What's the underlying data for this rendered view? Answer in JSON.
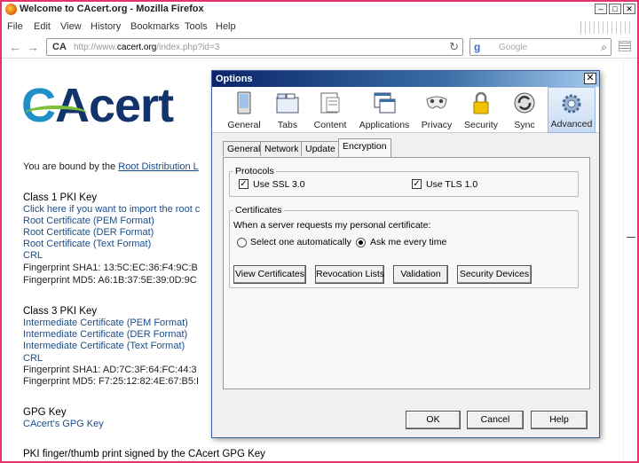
{
  "window": {
    "title": "Welcome to CAcert.org - Mozilla Firefox",
    "minimize": "–",
    "maximize": "□",
    "close": "✕"
  },
  "menu": [
    "File",
    "Edit",
    "View",
    "History",
    "Bookmarks",
    "Tools",
    "Help"
  ],
  "nav": {
    "back": "←",
    "forward": "→",
    "site_badge": "CA",
    "url_prefix": "http://www.",
    "url_domain": "cacert.org",
    "url_suffix": "/index.php?id=3",
    "reload": "↻",
    "search_engine": "g",
    "search_placeholder": "Google",
    "search_icon": "⌕"
  },
  "page": {
    "logo_c": "C",
    "logo_rest": "Acert",
    "bound_text": "You are bound by the ",
    "bound_link": "Root Distribution L",
    "class1": {
      "heading": "Class 1 PKI Key",
      "import": "Click here if you want to import the root c",
      "links": [
        "Root Certificate (PEM Format)",
        "Root Certificate (DER Format)",
        "Root Certificate (Text Format)",
        "CRL"
      ],
      "sha1": "Fingerprint SHA1: 13:5C:EC:36:F4:9C:B",
      "md5": "Fingerprint MD5: A6:1B:37:5E:39:0D:9C"
    },
    "class3": {
      "heading": "Class 3 PKI Key",
      "links": [
        "Intermediate Certificate (PEM Format)",
        "Intermediate Certificate (DER Format)",
        "Intermediate Certificate (Text Format)",
        "CRL"
      ],
      "sha1": "Fingerprint SHA1: AD:7C:3F:64:FC:44:3",
      "md5": "Fingerprint MD5: F7:25:12:82:4E:67:B5:I"
    },
    "gpg": {
      "heading": "GPG Key",
      "link": "CAcert's GPG Key"
    },
    "footer": "PKI finger/thumb print signed by the CAcert GPG Key"
  },
  "dialog": {
    "title": "Options",
    "close": "✕",
    "panes": [
      {
        "label": "General",
        "icon": "general-icon"
      },
      {
        "label": "Tabs",
        "icon": "tabs-icon"
      },
      {
        "label": "Content",
        "icon": "content-icon"
      },
      {
        "label": "Applications",
        "icon": "applications-icon"
      },
      {
        "label": "Privacy",
        "icon": "privacy-icon"
      },
      {
        "label": "Security",
        "icon": "security-icon"
      },
      {
        "label": "Sync",
        "icon": "sync-icon"
      },
      {
        "label": "Advanced",
        "icon": "advanced-icon"
      }
    ],
    "active_pane": "Advanced",
    "tabs": [
      "General",
      "Network",
      "Update",
      "Encryption"
    ],
    "selected_tab": "Encryption",
    "protocols": {
      "legend": "Protocols",
      "ssl_label": "Use SSL 3.0",
      "tls_label": "Use TLS 1.0",
      "ssl_checked": true,
      "tls_checked": true,
      "check_mark": "✓"
    },
    "certificates": {
      "legend": "Certificates",
      "prompt": "When a server requests my personal certificate:",
      "opt_auto": "Select one automatically",
      "opt_ask": "Ask me every time",
      "selected": "Ask me every time"
    },
    "cert_buttons": [
      "View Certificates",
      "Revocation Lists",
      "Validation",
      "Security Devices"
    ],
    "footer_buttons": {
      "ok": "OK",
      "cancel": "Cancel",
      "help": "Help"
    }
  }
}
